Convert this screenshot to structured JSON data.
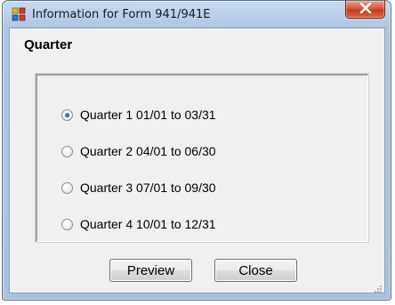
{
  "window": {
    "title": "Information for Form 941/941E",
    "icons": {
      "app": "window-app-icon",
      "close": "close-icon"
    }
  },
  "group": {
    "label": "Quarter",
    "options": [
      {
        "label": "Quarter 1  01/01  to  03/31",
        "checked": true
      },
      {
        "label": "Quarter 2  04/01  to  06/30",
        "checked": false
      },
      {
        "label": "Quarter 3  07/01  to  09/30",
        "checked": false
      },
      {
        "label": "Quarter 4  10/01  to  12/31",
        "checked": false
      }
    ]
  },
  "buttons": {
    "preview": "Preview",
    "close": "Close"
  },
  "colors": {
    "frame": "#b9cfe8",
    "close_button": "#c63a1f",
    "client": "#f0f0f0",
    "radio_dot": "#29479b"
  }
}
